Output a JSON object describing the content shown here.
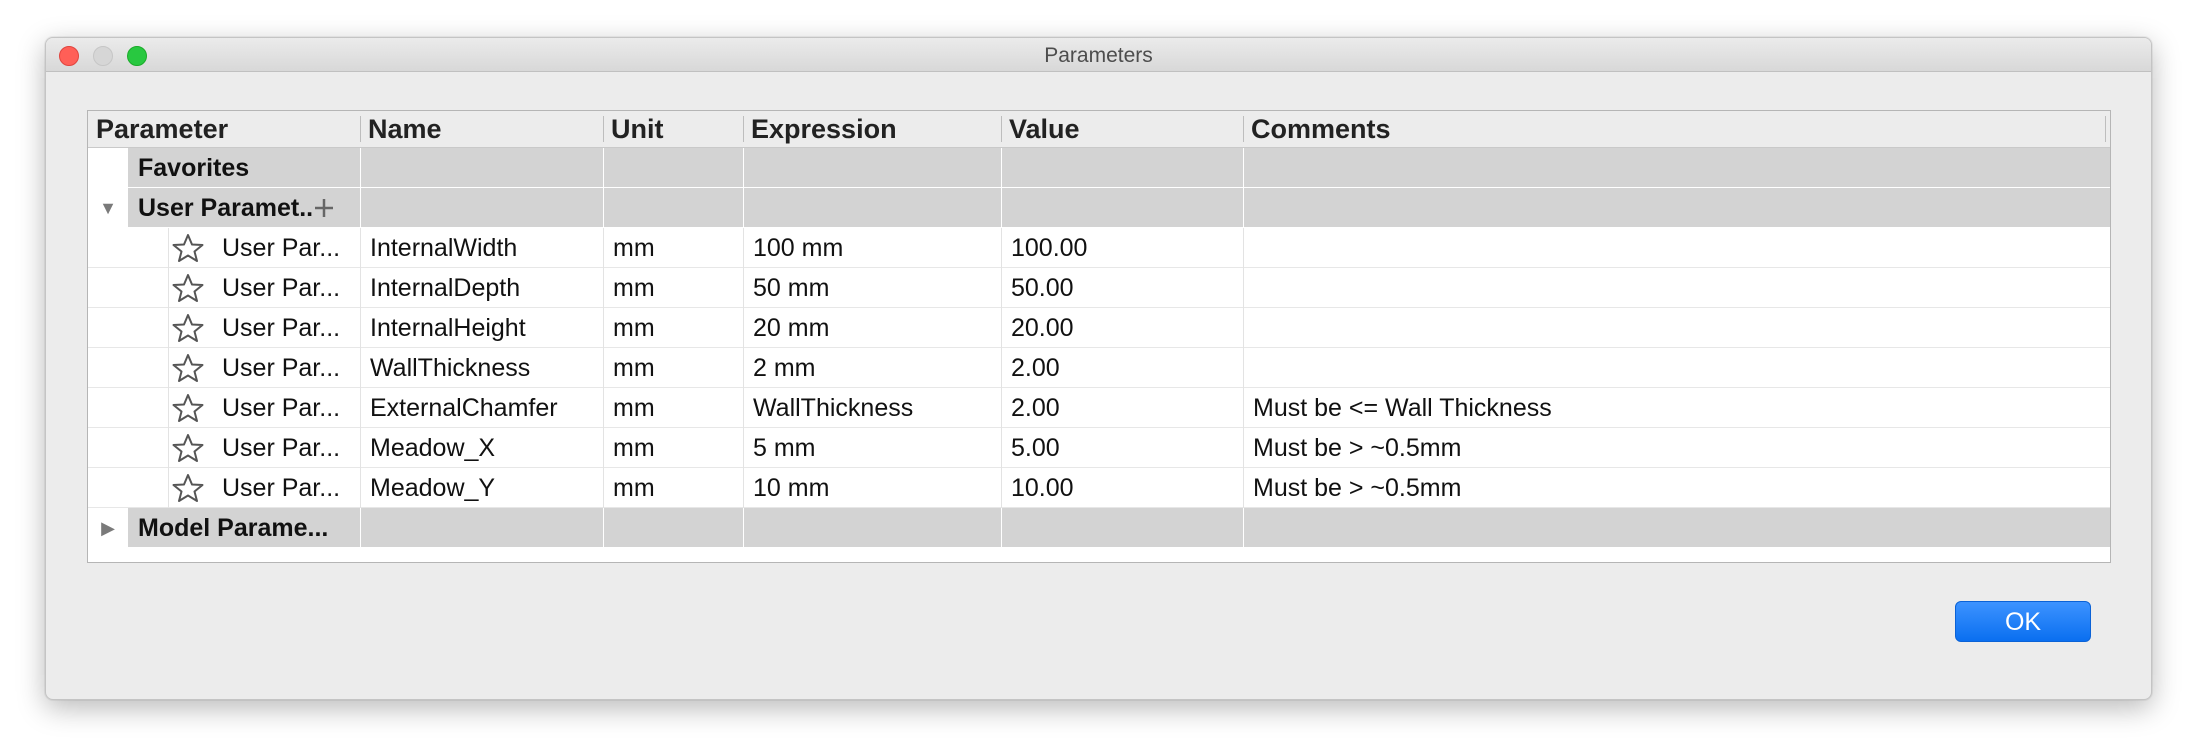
{
  "window": {
    "title": "Parameters"
  },
  "table": {
    "headers": {
      "parameter": "Parameter",
      "name": "Name",
      "unit": "Unit",
      "expression": "Expression",
      "value": "Value",
      "comments": "Comments"
    },
    "groups": {
      "favorites": {
        "label": "Favorites"
      },
      "user_parameters": {
        "label": "User Paramet..",
        "expanded": true
      },
      "model_parameters": {
        "label": "Model Parame...",
        "expanded": false
      }
    },
    "user_rows": [
      {
        "parameter": "User Par...",
        "name": "InternalWidth",
        "unit": "mm",
        "expression": "100 mm",
        "value": "100.00",
        "comment": ""
      },
      {
        "parameter": "User Par...",
        "name": "InternalDepth",
        "unit": "mm",
        "expression": "50 mm",
        "value": "50.00",
        "comment": ""
      },
      {
        "parameter": "User Par...",
        "name": "InternalHeight",
        "unit": "mm",
        "expression": "20 mm",
        "value": "20.00",
        "comment": ""
      },
      {
        "parameter": "User Par...",
        "name": "WallThickness",
        "unit": "mm",
        "expression": "2 mm",
        "value": "2.00",
        "comment": ""
      },
      {
        "parameter": "User Par...",
        "name": "ExternalChamfer",
        "unit": "mm",
        "expression": "WallThickness",
        "value": "2.00",
        "comment": "Must be <= Wall Thickness"
      },
      {
        "parameter": "User Par...",
        "name": "Meadow_X",
        "unit": "mm",
        "expression": "5 mm",
        "value": "5.00",
        "comment": "Must be > ~0.5mm"
      },
      {
        "parameter": "User Par...",
        "name": "Meadow_Y",
        "unit": "mm",
        "expression": "10 mm",
        "value": "10.00",
        "comment": "Must be > ~0.5mm"
      }
    ]
  },
  "buttons": {
    "ok_label": "OK"
  },
  "colors": {
    "accent": "#0a6ff0",
    "group_band": "#d3d3d3",
    "close": "#ff5f57",
    "maximize": "#28c840"
  },
  "icons": {
    "favorite": "star-outline-icon",
    "add": "plus-icon",
    "expanded": "triangle-down-icon",
    "collapsed": "triangle-right-icon"
  }
}
